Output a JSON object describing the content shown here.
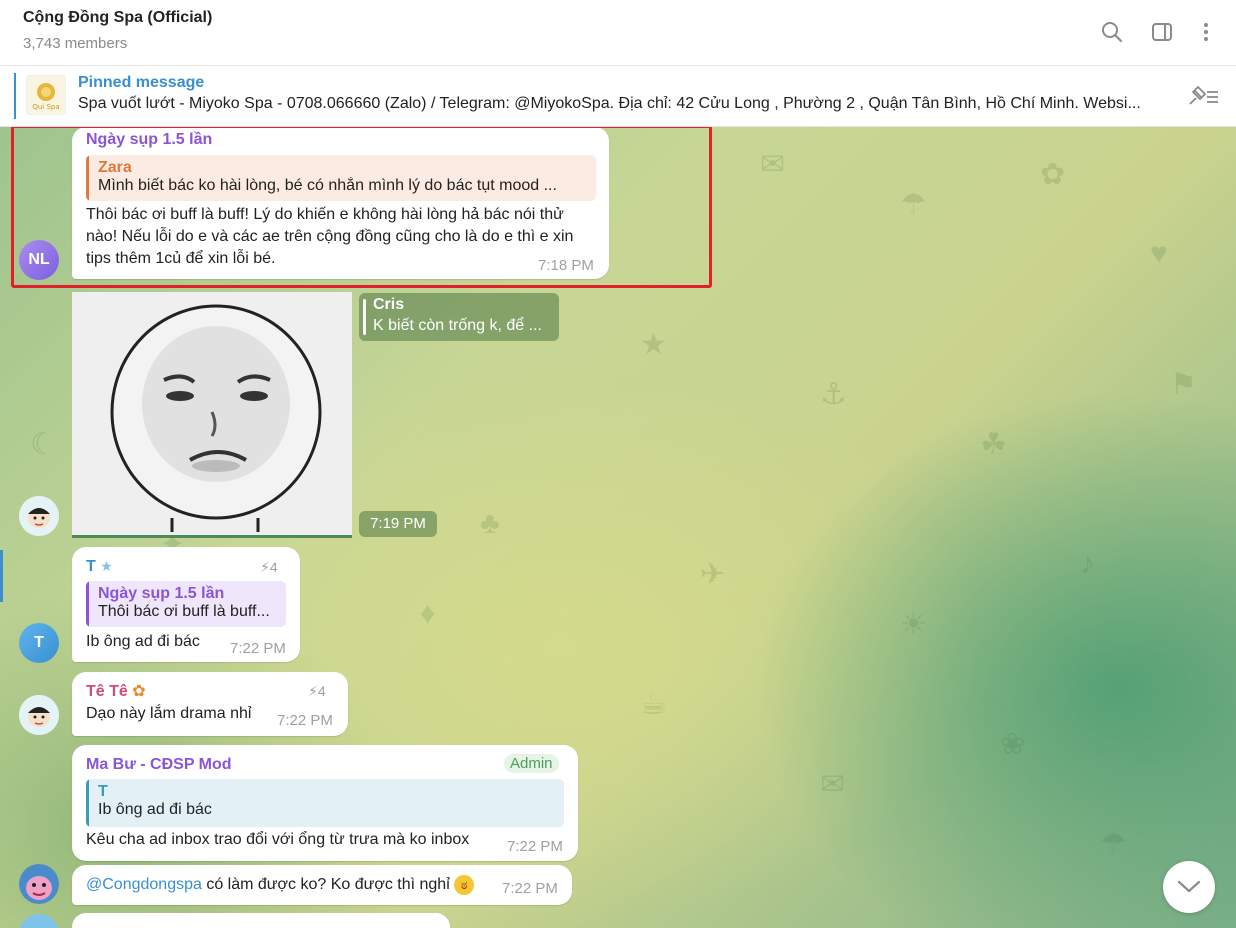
{
  "header": {
    "title": "Cộng Đồng Spa (Official)",
    "members": "3,743 members",
    "icons": [
      "search-icon",
      "sidebar-toggle-icon",
      "more-vertical-icon"
    ]
  },
  "pinned": {
    "label": "Pinned message",
    "text": "Spa vuốt lướt  - Miyoko Spa - 0708.066660 (Zalo) / Telegram: @MiyokoSpa.  Địa chỉ: 42 Cửu Long , Phường 2 , Quận Tân Bình, Hồ Chí Minh. Websi...",
    "thumb_label": "Qui Spa",
    "icon": "pin-list-icon"
  },
  "colors": {
    "accent": "#3a8fd0",
    "highlight_border": "#e0202a",
    "admin_badge": "#4aa05a"
  },
  "messages": [
    {
      "sender": "Ngày sụp 1.5 lần",
      "reply_name": "Zara",
      "reply_text": "Mình biết bác ko hài lòng, bé có nhắn mình lý do bác tụt mood ...",
      "text": "Thôi bác ơi buff là buff! Lý do khiến e không hài lòng hả bác nói thử nào! Nếu lỗi do e và các ae trên cộng đồng cũng cho là do e thì e xin tips thêm 1củ để xin lỗi bé.",
      "time": "7:18 PM",
      "avatar": "NL"
    },
    {
      "reply_name": "Cris",
      "reply_text": "K biết còn trống k, để ...",
      "time": "7:19 PM",
      "sticker": "crying-face-sticker"
    },
    {
      "sender": "T",
      "reply_name": "Ngày sụp 1.5 lần",
      "reply_text": "Thôi bác ơi buff là buff...",
      "text": "Ib ông ad đi bác",
      "time": "7:22 PM",
      "boost": "4",
      "avatar": "T"
    },
    {
      "sender": "Tê Tê",
      "text": "Dạo này lắm drama nhỉ",
      "time": "7:22 PM",
      "boost": "4"
    },
    {
      "sender": "Ma Bư - CĐSP Mod",
      "badge": "Admin",
      "reply_name": "T",
      "reply_text": "Ib ông ad đi bác",
      "text": "Kêu cha ad inbox trao đổi với ổng từ trưa mà ko inbox",
      "time": "7:22 PM"
    },
    {
      "mention": "@Congdongspa",
      "text": " có làm được ko? Ko được thì nghỉ",
      "time": "7:22 PM"
    }
  ]
}
